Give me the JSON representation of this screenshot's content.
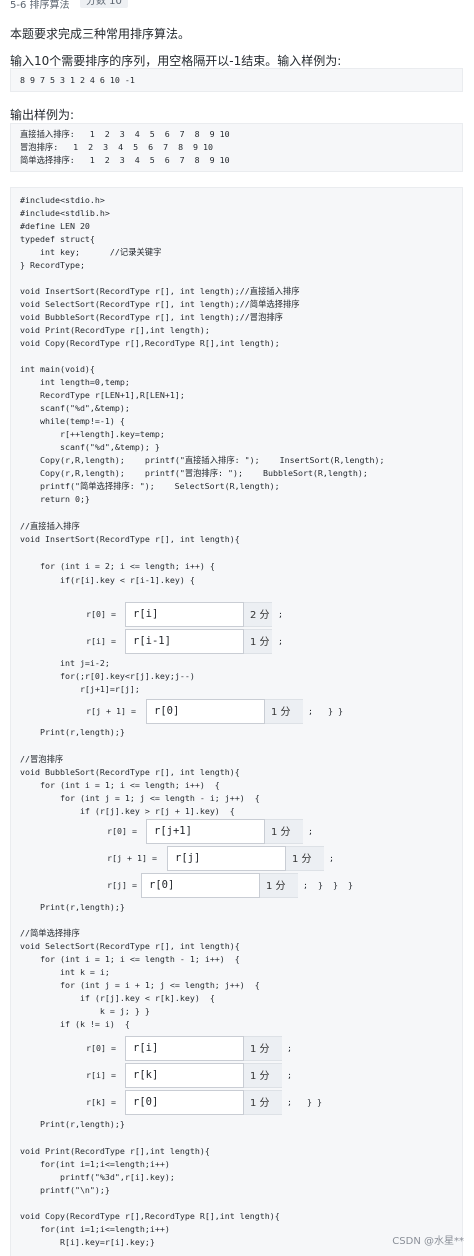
{
  "header": {
    "title": "5-6 排序算法",
    "score": "分数 10"
  },
  "intro": "本题要求完成三种常用排序算法。",
  "input_heading": "输入10个需要排序的序列，用空格隔开以-1结束。输入样例为:",
  "input_sample": "8 9 7 5 3 1 2 4 6 10 -1",
  "output_heading": "输出样例为:",
  "output_sample": [
    "直接插入排序:   1  2  3  4  5  6  7  8  9 10",
    "冒泡排序:   1  2  3  4  5  6  7  8  9 10",
    "简单选择排序:   1  2  3  4  5  6  7  8  9 10"
  ],
  "code_lines": [
    "#include<stdio.h>",
    "#include<stdlib.h>",
    "#define LEN 20",
    "typedef struct{",
    "    int key;      //记录关键字",
    "} RecordType;",
    "",
    "void InsertSort(RecordType r[], int length);//直接插入排序",
    "void SelectSort(RecordType r[], int length);//简单选择排序",
    "void BubbleSort(RecordType r[], int length);//冒泡排序",
    "void Print(RecordType r[],int length);",
    "void Copy(RecordType r[],RecordType R[],int length);",
    "",
    "int main(void){",
    "    int length=0,temp;",
    "    RecordType r[LEN+1],R[LEN+1];",
    "    scanf(\"%d\",&temp);",
    "    while(temp!=-1) {",
    "        r[++length].key=temp;",
    "        scanf(\"%d\",&temp); }",
    "    Copy(r,R,length);    printf(\"直接插入排序: \");    InsertSort(R,length);",
    "    Copy(r,R,length);    printf(\"冒泡排序: \");    BubbleSort(R,length);",
    "    printf(\"简单选择排序: \");    SelectSort(R,length);",
    "    return 0;}",
    "",
    "//直接插入排序",
    "void InsertSort(RecordType r[], int length){",
    "",
    "    for (int i = 2; i <= length; i++) {",
    "        if(r[i].key < r[i-1].key) {",
    "        int j=i-2;",
    "        for(;r[0].key<r[j].key;j--)",
    "            r[j+1]=r[j];",
    "    Print(r,length);}",
    "",
    "//冒泡排序",
    "void BubbleSort(RecordType r[], int length){",
    "    for (int i = 1; i <= length; i++)  {",
    "        for (int j = 1; j <= length - i; j++)  {",
    "            if (r[j].key > r[j + 1].key)  {",
    "    Print(r,length);}",
    "",
    "//简单选择排序",
    "void SelectSort(RecordType r[], int length){",
    "    for (int i = 1; i <= length - 1; i++)  {",
    "        int k = i;",
    "        for (int j = i + 1; j <= length; j++)  {",
    "            if (r[j].key < r[k].key)  {",
    "                k = j; } }",
    "        if (k != i)  {",
    "    Print(r,length);}",
    "",
    "void Print(RecordType r[],int length){",
    "    for(int i=1;i<=length;i++)",
    "        printf(\"%3d\",r[i].key);",
    "    printf(\"\\n\");}",
    "",
    "void Copy(RecordType r[],RecordType R[],int length){",
    "    for(int i=1;i<=length;i++)",
    "        R[i].key=r[i].key;}"
  ],
  "blanks": [
    {
      "label": "r[0] =",
      "answer": "r[i]",
      "score": "2 分",
      "after": ";"
    },
    {
      "label": "r[i] =",
      "answer": "r[i-1]",
      "score": "1 分",
      "after": ";"
    },
    {
      "label": "r[j + 1] =",
      "answer": "r[0]",
      "score": "1 分",
      "after": ";   } }"
    },
    {
      "label": "r[0] =",
      "answer": "r[j+1]",
      "score": "1 分",
      "after": ";"
    },
    {
      "label": "r[j + 1] =",
      "answer": "r[j]",
      "score": "1 分",
      "after": ";"
    },
    {
      "label": "r[j] =",
      "answer": "r[0]",
      "score": "1 分",
      "after": ";  }  }  }"
    },
    {
      "label": "r[0] =",
      "answer": "r[i]",
      "score": "1 分",
      "after": ";"
    },
    {
      "label": "r[i] =",
      "answer": "r[k]",
      "score": "1 分",
      "after": ";"
    },
    {
      "label": "r[k] =",
      "answer": "r[0]",
      "score": "1 分",
      "after": ";   } }"
    }
  ],
  "watermark": "CSDN @水星**"
}
